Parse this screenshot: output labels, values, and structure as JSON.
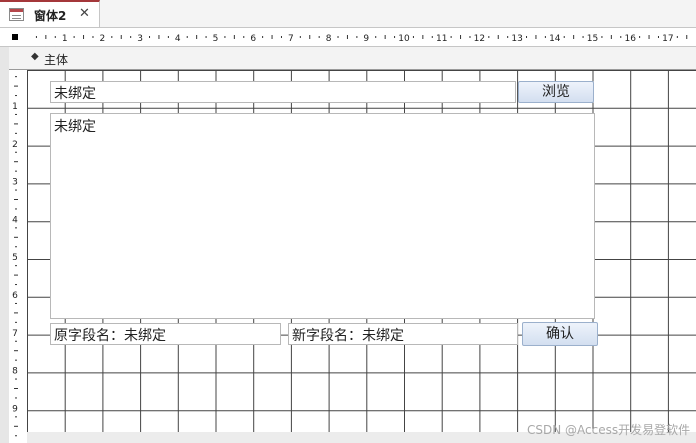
{
  "tab": {
    "title": "窗体2",
    "close": "✕"
  },
  "ruler": {
    "h_numbers": [
      "1",
      "2",
      "3",
      "4",
      "5",
      "6",
      "7",
      "8",
      "9",
      "10",
      "11",
      "12",
      "13",
      "14",
      "15",
      "16",
      "17"
    ],
    "v_numbers": [
      "1",
      "2",
      "3",
      "4",
      "5",
      "6",
      "7",
      "8",
      "9"
    ]
  },
  "section": {
    "arrow": "◆",
    "label": "主体"
  },
  "form": {
    "path_box": "未绑定",
    "browse_button": "浏览",
    "list_box": "未绑定",
    "old_field_label": "原字段名：",
    "old_field_value": "未绑定",
    "new_field_label": "新字段名：",
    "new_field_value": "未绑定",
    "confirm_button": "确认"
  },
  "watermark": "CSDN @Access开发易登软件"
}
